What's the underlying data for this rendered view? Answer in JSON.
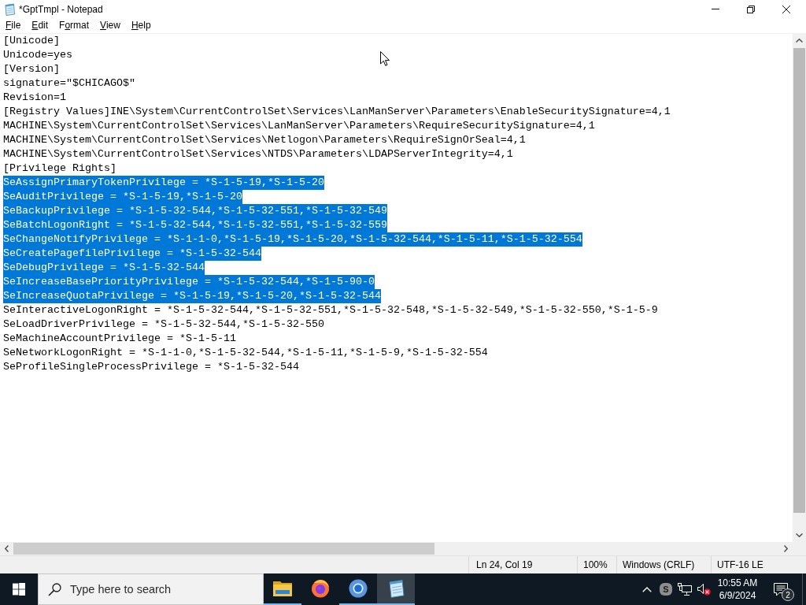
{
  "window": {
    "title": "*GptTmpl - Notepad"
  },
  "menu": [
    {
      "key": "F",
      "post": "ile"
    },
    {
      "key": "E",
      "post": "dit"
    },
    {
      "pre": "F",
      "key": "o",
      "post": "rmat"
    },
    {
      "key": "V",
      "post": "iew"
    },
    {
      "key": "H",
      "post": "elp"
    }
  ],
  "editor": {
    "lines": [
      {
        "text": "[Unicode]",
        "selected": false
      },
      {
        "text": "Unicode=yes",
        "selected": false
      },
      {
        "text": "[Version]",
        "selected": false
      },
      {
        "text": "signature=\"$CHICAGO$\"",
        "selected": false
      },
      {
        "text": "Revision=1",
        "selected": false
      },
      {
        "text": "[Registry Values]INE\\System\\CurrentControlSet\\Services\\LanManServer\\Parameters\\EnableSecuritySignature=4,1",
        "selected": false
      },
      {
        "text": "MACHINE\\System\\CurrentControlSet\\Services\\LanManServer\\Parameters\\RequireSecuritySignature=4,1",
        "selected": false
      },
      {
        "text": "MACHINE\\System\\CurrentControlSet\\Services\\Netlogon\\Parameters\\RequireSignOrSeal=4,1",
        "selected": false
      },
      {
        "text": "MACHINE\\System\\CurrentControlSet\\Services\\NTDS\\Parameters\\LDAPServerIntegrity=4,1",
        "selected": false
      },
      {
        "text": "[Privilege Rights]",
        "selected": false
      },
      {
        "text": "SeAssignPrimaryTokenPrivilege = *S-1-5-19,*S-1-5-20",
        "selected": true
      },
      {
        "text": "SeAuditPrivilege = *S-1-5-19,*S-1-5-20",
        "selected": true
      },
      {
        "text": "SeBackupPrivilege = *S-1-5-32-544,*S-1-5-32-551,*S-1-5-32-549",
        "selected": true
      },
      {
        "text": "SeBatchLogonRight = *S-1-5-32-544,*S-1-5-32-551,*S-1-5-32-559",
        "selected": true
      },
      {
        "text": "SeChangeNotifyPrivilege = *S-1-1-0,*S-1-5-19,*S-1-5-20,*S-1-5-32-544,*S-1-5-11,*S-1-5-32-554",
        "selected": true
      },
      {
        "text": "SeCreatePagefilePrivilege = *S-1-5-32-544",
        "selected": true
      },
      {
        "text": "SeDebugPrivilege = *S-1-5-32-544",
        "selected": true
      },
      {
        "text": "SeIncreaseBasePriorityPrivilege = *S-1-5-32-544,*S-1-5-90-0",
        "selected": true
      },
      {
        "text": "SeIncreaseQuotaPrivilege = *S-1-5-19,*S-1-5-20,*S-1-5-32-544",
        "selected": true
      },
      {
        "text": "SeInteractiveLogonRight = *S-1-5-32-544,*S-1-5-32-551,*S-1-5-32-548,*S-1-5-32-549,*S-1-5-32-550,*S-1-5-9",
        "selected": false
      },
      {
        "text": "SeLoadDriverPrivilege = *S-1-5-32-544,*S-1-5-32-550",
        "selected": false
      },
      {
        "text": "SeMachineAccountPrivilege = *S-1-5-11",
        "selected": false
      },
      {
        "text": "SeNetworkLogonRight = *S-1-1-0,*S-1-5-32-544,*S-1-5-11,*S-1-5-9,*S-1-5-32-554",
        "selected": false
      },
      {
        "text": "SeProfileSingleProcessPrivilege = *S-1-5-32-544",
        "selected": false
      }
    ]
  },
  "status_bar": {
    "position": "Ln 24, Col 19",
    "zoom": "100%",
    "line_ending": "Windows (CRLF)",
    "encoding": "UTF-16 LE"
  },
  "taskbar": {
    "search": {
      "placeholder": "Type here to search"
    },
    "apps": [
      {
        "kind": "explorer",
        "running": true,
        "active": false
      },
      {
        "kind": "firefox",
        "running": false,
        "active": false
      },
      {
        "kind": "chrome",
        "running": true,
        "active": false
      },
      {
        "kind": "notepad",
        "running": true,
        "active": true
      }
    ],
    "tray": {
      "app_letter": "S",
      "volume_muted": true
    },
    "clock": {
      "time": "10:55 AM",
      "date": "6/9/2024"
    },
    "notifications": {
      "count": "2"
    }
  }
}
